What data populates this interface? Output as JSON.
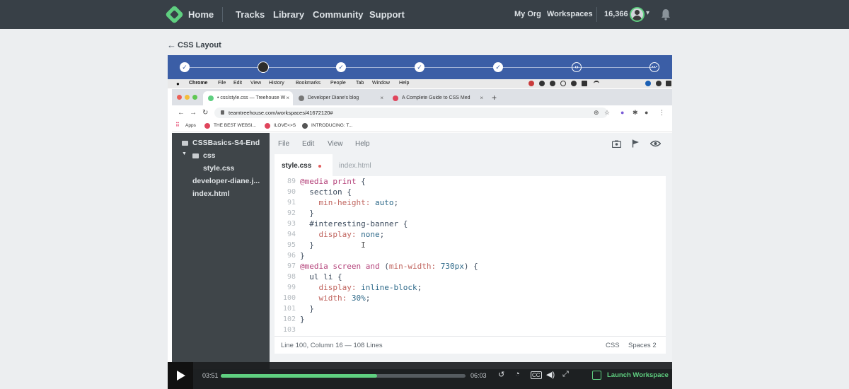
{
  "nav": {
    "home": "Home",
    "tracks": "Tracks",
    "library": "Library",
    "community": "Community",
    "support": "Support",
    "my_org": "My Org",
    "workspaces": "Workspaces",
    "points": "16,366"
  },
  "breadcrumb": {
    "arrow": "←",
    "title": "CSS Layout"
  },
  "steps": [
    {
      "glyph": "✓"
    },
    {
      "glyph": ""
    },
    {
      "glyph": "✓"
    },
    {
      "glyph": "✓"
    },
    {
      "glyph": "✓"
    },
    {
      "glyph": "‹›"
    },
    {
      "glyph": "⋯"
    }
  ],
  "mac_menu": [
    "Chrome",
    "File",
    "Edit",
    "View",
    "History",
    "Bookmarks",
    "People",
    "Tab",
    "Window",
    "Help"
  ],
  "browser": {
    "tabs": [
      {
        "label": "• css/style.css — Treehouse W",
        "fav_color": "#5fcf80"
      },
      {
        "label": "Developer Diane's blog",
        "fav_color": "#777777"
      },
      {
        "label": "A Complete Guide to CSS Med",
        "fav_color": "#e0455c"
      }
    ],
    "url": "teamtreehouse.com/workspaces/41672120#",
    "bookmarks": [
      "Apps",
      "THE BEST WEBSI...",
      "ILOVE<>S",
      "INTRODUCING: T..."
    ]
  },
  "workspace": {
    "tree": [
      {
        "label": "CSSBasics-S4-End"
      },
      {
        "label": "css"
      },
      {
        "label": "style.css"
      },
      {
        "label": "developer-diane.j..."
      },
      {
        "label": "index.html"
      }
    ],
    "menu": [
      "File",
      "Edit",
      "View",
      "Help"
    ],
    "tabs": {
      "active": "style.css",
      "inactive": "index.html"
    },
    "line_numbers": [
      "89",
      "90",
      "91",
      "92",
      "93",
      "94",
      "95",
      "96",
      "97",
      "98",
      "99",
      "100",
      "101",
      "102",
      "103"
    ],
    "status": {
      "position": "Line 100, Column 16 — 108 Lines",
      "mode": "CSS",
      "spaces": "Spaces 2"
    }
  },
  "player": {
    "current_time": "03:51",
    "duration": "06:03",
    "progress": 0.64,
    "launch_label": "Launch Workspace"
  },
  "colors": {
    "accent": "#5fcf80",
    "nav_bg": "#384047",
    "steps_bg": "#3b5ea6"
  }
}
